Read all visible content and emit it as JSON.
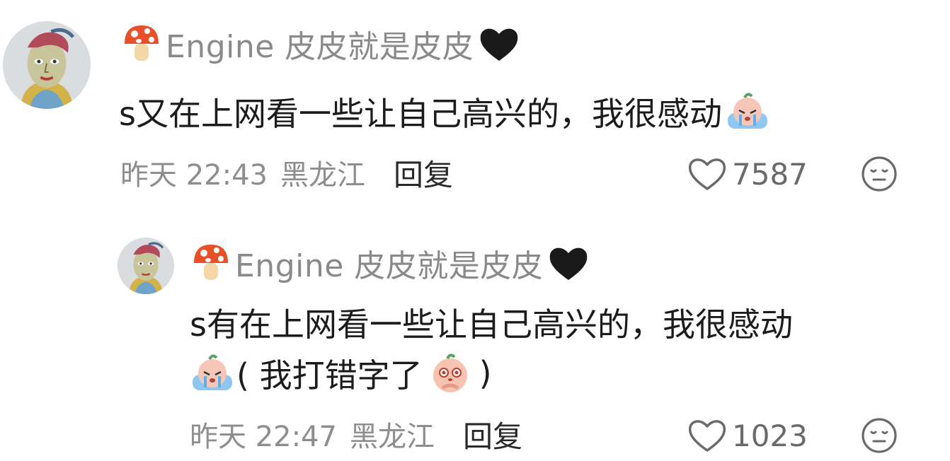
{
  "comments": [
    {
      "username": "Engine 皮皮就是皮皮",
      "text": "s又在上网看一些让自己高兴的，我很感动",
      "time": "昨天 22:43",
      "location": "黑龙江",
      "reply_label": "回复",
      "likes": "7587",
      "icons": [
        "mushroom-icon",
        "black-heart-icon",
        "crying-emoji-icon",
        "heart-outline-icon",
        "neutral-face-icon"
      ]
    },
    {
      "username": "Engine 皮皮就是皮皮",
      "text_line1": "s有在上网看一些让自己高兴的，我很感动",
      "text_line2": "(  我打错字了",
      "text_line2_end": ")",
      "time": "昨天 22:47",
      "location": "黑龙江",
      "reply_label": "回复",
      "likes": "1023",
      "icons": [
        "mushroom-icon",
        "black-heart-icon",
        "crying-emoji-icon",
        "pleading-emoji-icon",
        "heart-outline-icon",
        "neutral-face-icon"
      ]
    }
  ],
  "colors": {
    "username": "#8a8a8a",
    "text": "#1c1c1c",
    "meta": "#8e8e8e",
    "reply": "#2a2a2a"
  }
}
